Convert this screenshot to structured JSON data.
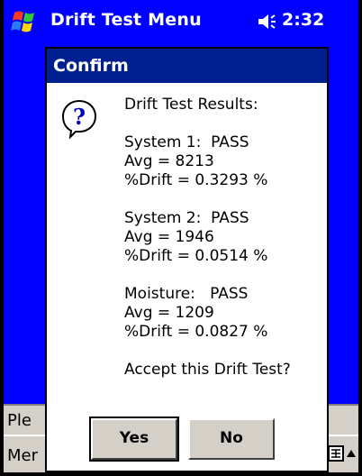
{
  "titlebar": {
    "title": "Drift Test Menu",
    "clock": "2:32",
    "start_icon": "windows-flag-icon",
    "volume_icon": "speaker-icon"
  },
  "underlying": {
    "row1_label": "Ple",
    "row2_label": "Mer"
  },
  "dialog": {
    "caption": "Confirm",
    "icon": "question-icon",
    "lines": {
      "heading": "Drift Test Results:",
      "s1_status": "System 1:  PASS",
      "s1_avg": "Avg = 8213",
      "s1_drift": "%Drift = 0.3293 %",
      "s2_status": "System 2:  PASS",
      "s2_avg": "Avg = 1946",
      "s2_drift": "%Drift = 0.0514 %",
      "m_status": "Moisture:   PASS",
      "m_avg": "Avg = 1209",
      "m_drift": "%Drift = 0.0827 %",
      "prompt": "Accept this Drift Test?"
    },
    "buttons": {
      "yes": "Yes",
      "no": "No"
    }
  },
  "colors": {
    "titlebar_bg": "#0000ff",
    "caption_bg": "#001f8f",
    "button_face": "#d4d0c8"
  }
}
